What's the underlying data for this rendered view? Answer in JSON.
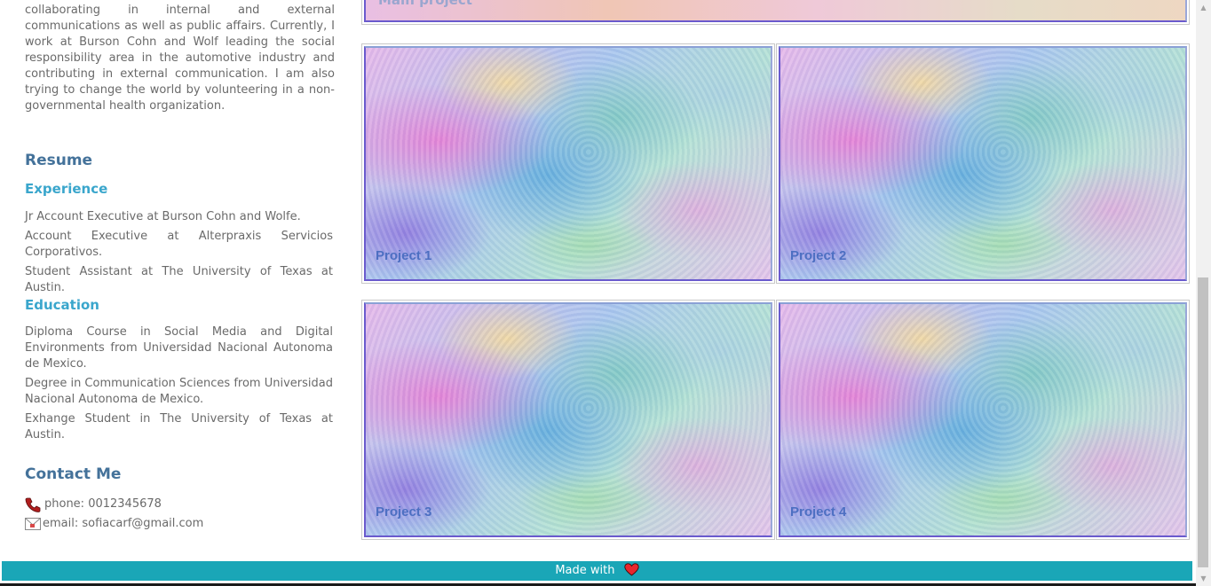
{
  "about": {
    "text": "collaborating in internal and external communications as well as public affairs. Currently, I work at Burson Cohn and Wolf leading the social responsibility area in the automotive industry and contributing in external communication. I am also trying to change the world by volunteering in a non-governmental health organization."
  },
  "resume": {
    "title": "Resume",
    "experience": {
      "title": "Experience",
      "items": [
        "Jr Account Executive at Burson Cohn and Wolfe.",
        "Account Executive at Alterpraxis Servicios Corporativos.",
        "Student Assistant at The University of Texas at Austin."
      ]
    },
    "education": {
      "title": "Education",
      "items": [
        "Diploma Course in Social Media and Digital Environments from Universidad Nacional Autonoma de Mexico.",
        "Degree in Communication Sciences from Universidad Nacional Autonoma de Mexico.",
        "Exhange Student in The University of Texas at Austin."
      ]
    }
  },
  "contact": {
    "title": "Contact Me",
    "phone": "phone: 0012345678",
    "email": "email: sofiacarf@gmail.com",
    "phone_icon": "phone-icon",
    "email_icon": "mail-icon"
  },
  "projects": {
    "main_label": "Main project",
    "items": [
      {
        "label": "Project 1"
      },
      {
        "label": "Project 2"
      },
      {
        "label": "Project 3"
      },
      {
        "label": "Project 4"
      }
    ]
  },
  "footer": {
    "text": "Made with",
    "icon": "heart-icon",
    "background": "#1aa6b7"
  },
  "colors": {
    "heading": "#44729a",
    "subheading": "#3aa6cc",
    "body_text": "#6a6a6a",
    "project_label": "#4d6fc2"
  }
}
